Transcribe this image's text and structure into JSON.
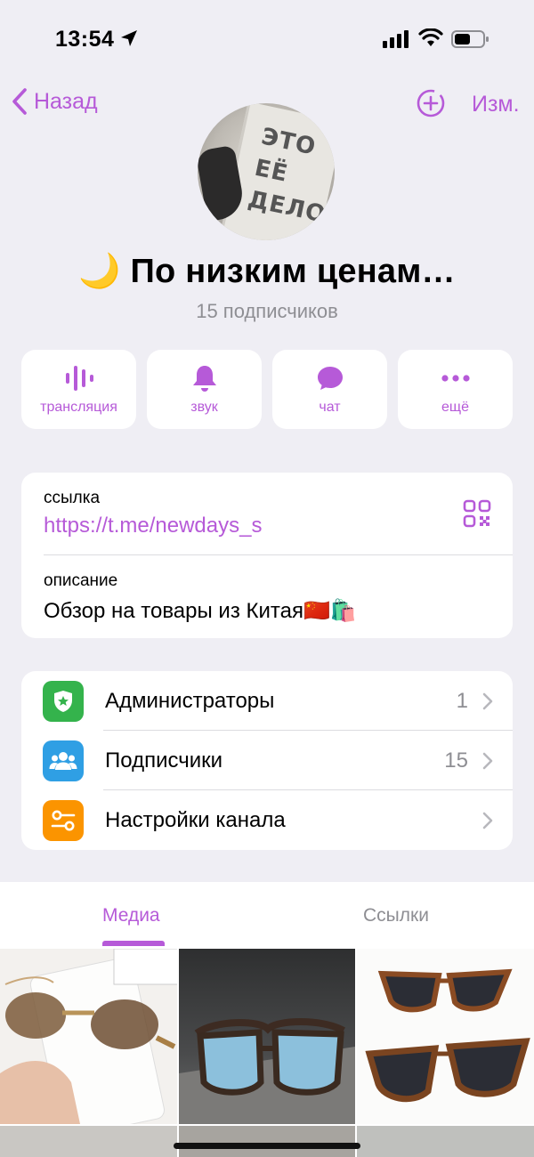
{
  "status_bar": {
    "time": "13:54"
  },
  "nav": {
    "back_label": "Назад",
    "edit_label": "Изм."
  },
  "channel": {
    "title": "🌙 По низким ценам…",
    "subscribers": "15 подписчиков",
    "avatar_text": [
      "ЭТО",
      "ЕЁ",
      "ДЕЛО"
    ]
  },
  "actions": [
    {
      "label": "трансляция",
      "icon": "broadcast-icon"
    },
    {
      "label": "звук",
      "icon": "bell-icon"
    },
    {
      "label": "чат",
      "icon": "chat-bubble-icon"
    },
    {
      "label": "ещё",
      "icon": "more-icon"
    }
  ],
  "info": {
    "link_caption": "ссылка",
    "link": "https://t.me/newdays_s",
    "description_caption": "описание",
    "description": "Обзор на товары из Китая",
    "description_emoji": "🇨🇳🛍️"
  },
  "list": [
    {
      "label": "Администраторы",
      "count": "1",
      "icon": "admin-shield-icon",
      "color": "#34b34c"
    },
    {
      "label": "Подписчики",
      "count": "15",
      "icon": "people-icon",
      "color": "#2f9fe4"
    },
    {
      "label": "Настройки канала",
      "count": "",
      "icon": "settings-sliders-icon",
      "color": "#fb9400"
    }
  ],
  "tabs": [
    {
      "label": "Медиа",
      "active": true
    },
    {
      "label": "Ссылки",
      "active": false
    }
  ],
  "media_images": [
    "sunglasses-brown-rimless",
    "sunglasses-blue-tint",
    "sunglasses-tortoise-cateye"
  ],
  "colors": {
    "accent": "#b65ad8",
    "background": "#efeef4",
    "card": "#ffffff",
    "secondary_text": "#8e8e93"
  }
}
